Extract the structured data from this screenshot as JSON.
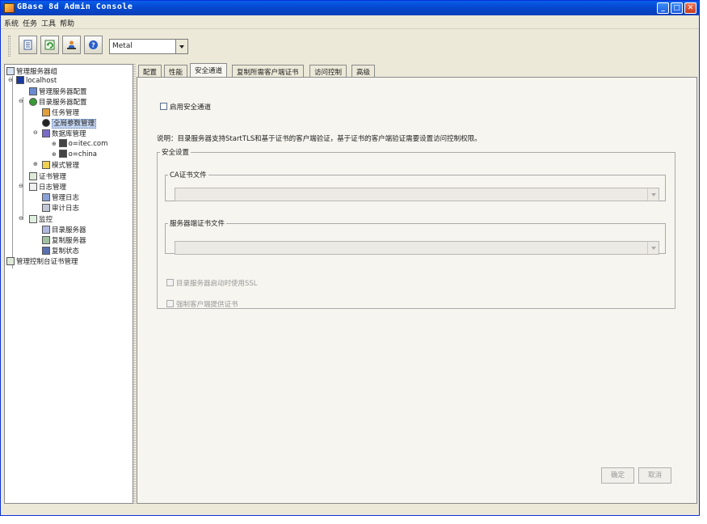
{
  "window": {
    "title": "GBase 8d  Admin  Console",
    "minimize_label": "_",
    "maximize_label": "□",
    "close_label": "✕"
  },
  "menu": [
    "系统",
    "任务",
    "工具",
    "帮助"
  ],
  "toolbar": {
    "buttons": [
      "page-icon",
      "refresh-icon",
      "users-icon",
      "help-icon"
    ],
    "lookandfeel_value": "Metal"
  },
  "tree": {
    "root": "管理服务器组",
    "host": "localhost",
    "admin_config": "管理服务器配置",
    "dir_config": "目录服务器配置",
    "task_mgmt": "任务管理",
    "global_params": "全局参数管理",
    "db_mgmt": "数据库管理",
    "db1": "o=itec.com",
    "db2": "o=china",
    "schema_mgmt": "模式管理",
    "cert_mgmt": "证书管理",
    "log_mgmt": "日志管理",
    "admin_log": "管理日志",
    "audit_log": "审计日志",
    "monitor": "监控",
    "dir_server": "目录服务器",
    "repl_server": "复制服务器",
    "repl_status": "复制状态",
    "console_cert": "管理控制台证书管理"
  },
  "tabs": [
    "配置",
    "性能",
    "安全通道",
    "复制所需客户端证书",
    "访问控制",
    "高级"
  ],
  "security": {
    "enable_label": "启用安全通道",
    "description": "说明：目录服务器支持StartTLS和基于证书的客户端验证，基于证书的客户端验证需要设置访问控制权限。",
    "group_label": "安全设置",
    "ca_label": "CA证书文件",
    "server_cert_label": "服务器端证书文件",
    "ssl_on_start_label": "目录服务器启动时使用SSL",
    "force_client_cert_label": "强制客户端提供证书"
  },
  "buttons": {
    "ok": "确定",
    "cancel": "取消"
  },
  "colors": {
    "titlebar": "#0548d0",
    "selection": "#c5d6f3",
    "face": "#ece9d8"
  }
}
